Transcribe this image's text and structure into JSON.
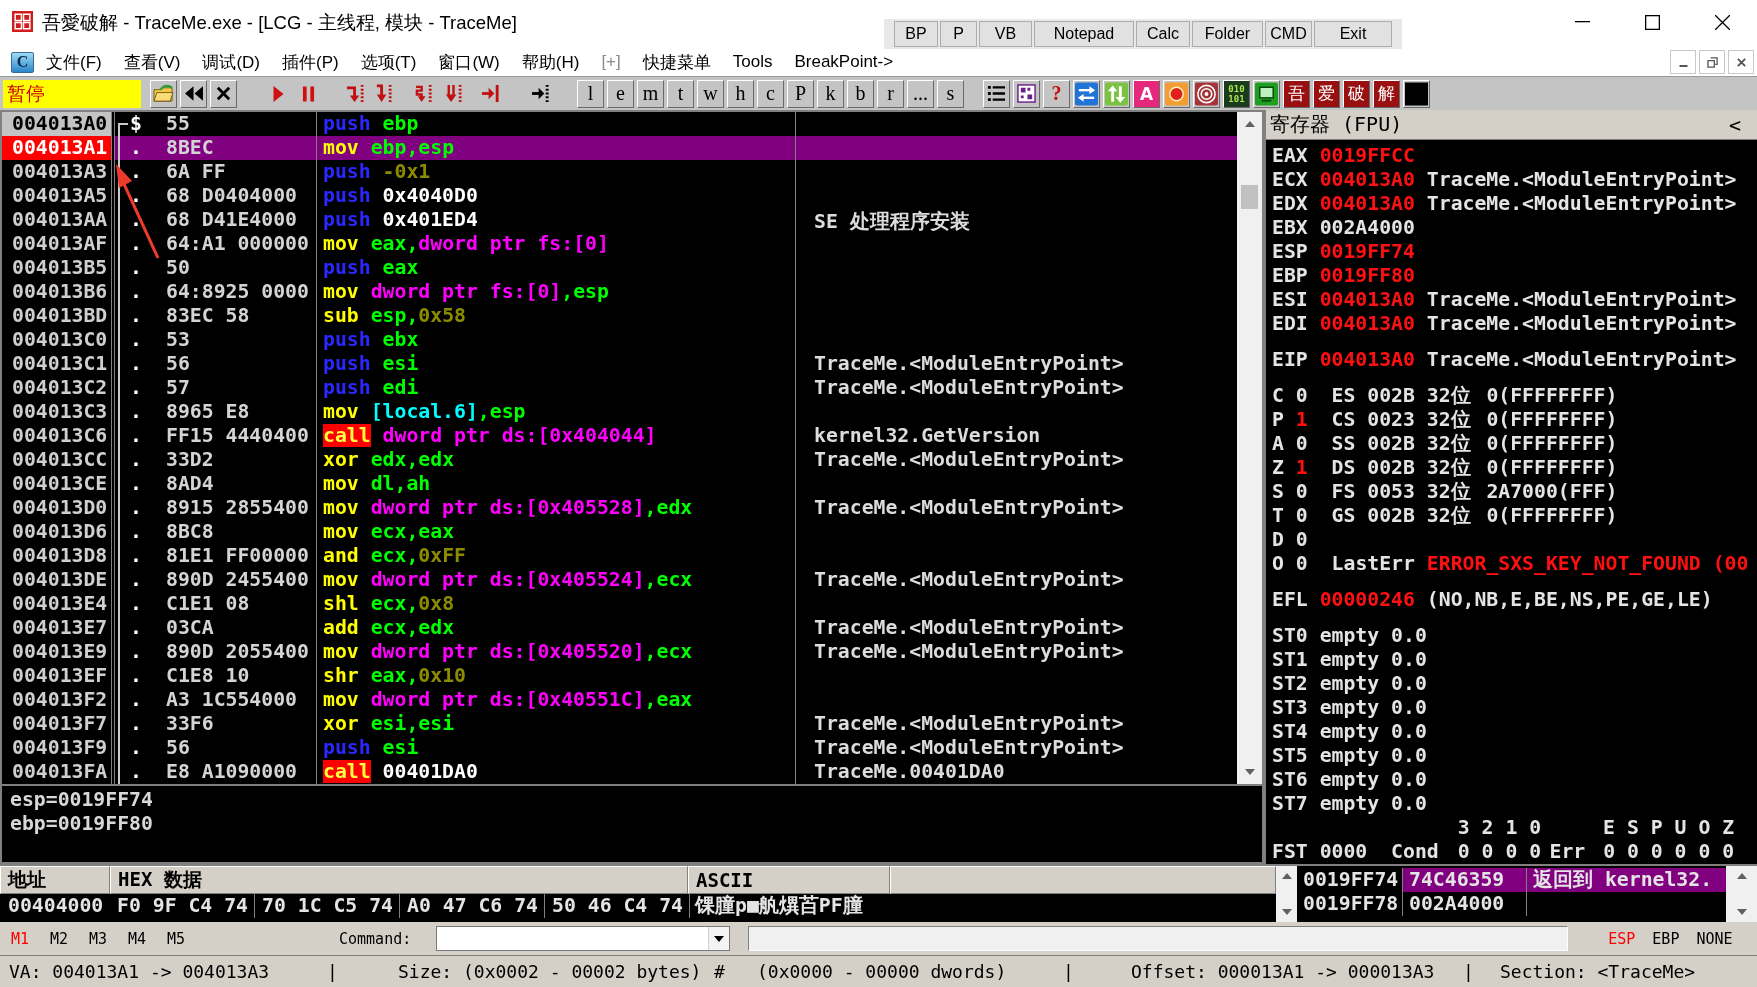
{
  "window": {
    "title": "吾愛破解 - TraceMe.exe - [LCG - 主线程, 模块 - TraceMe]"
  },
  "quick_buttons": [
    "BP",
    "P",
    "VB",
    "Notepad",
    "Calc",
    "Folder",
    "CMD",
    "Exit"
  ],
  "menu": {
    "icon_letter": "C",
    "items": [
      {
        "label": "文件(F)",
        "disabled": false
      },
      {
        "label": "查看(V)",
        "disabled": false
      },
      {
        "label": "调试(D)",
        "disabled": false
      },
      {
        "label": "插件(P)",
        "disabled": false
      },
      {
        "label": "选项(T)",
        "disabled": false
      },
      {
        "label": "窗口(W)",
        "disabled": false
      },
      {
        "label": "帮助(H)",
        "disabled": false
      },
      {
        "label": "[+]",
        "disabled": true
      },
      {
        "label": "快捷菜单",
        "disabled": false
      },
      {
        "label": "Tools",
        "disabled": false
      },
      {
        "label": "BreakPoint->",
        "disabled": false
      }
    ]
  },
  "toolbar": {
    "status": "暂停",
    "letter_buttons": [
      "l",
      "e",
      "m",
      "t",
      "w",
      "h",
      "c",
      "P",
      "k",
      "b",
      "r",
      "...",
      "s"
    ],
    "help_label": "?",
    "letter_tile": "A",
    "binary_tile": [
      "010",
      "101"
    ],
    "glyph_tiles": [
      "吾",
      "爱",
      "破",
      "解"
    ]
  },
  "disassembly": {
    "rows": [
      {
        "address": "004013A0",
        "selected": false,
        "eip": true,
        "marker": "$",
        "hex": "55",
        "mnemonic": {
          "text": "push",
          "kind": "stack"
        },
        "operands": [
          {
            "text": "ebp",
            "kind": "reg"
          }
        ]
      },
      {
        "address": "004013A1",
        "selected": true,
        "eip": false,
        "marker": ".",
        "hex": "8BEC",
        "mnemonic": {
          "text": "mov",
          "kind": "op"
        },
        "operands": [
          {
            "text": "ebp",
            "kind": "reg"
          },
          {
            "text": ",",
            "kind": "sep"
          },
          {
            "text": "esp",
            "kind": "reg"
          }
        ]
      },
      {
        "address": "004013A3",
        "selected": false,
        "eip": false,
        "marker": ".",
        "hex": "6A FF",
        "mnemonic": {
          "text": "push",
          "kind": "stack"
        },
        "operands": [
          {
            "text": "-0x1",
            "kind": "imm"
          }
        ]
      },
      {
        "address": "004013A5",
        "selected": false,
        "eip": false,
        "marker": ".",
        "hex": "68 D0404000",
        "mnemonic": {
          "text": "push",
          "kind": "stack"
        },
        "operands": [
          {
            "text": "0x4040D0",
            "kind": "const"
          }
        ]
      },
      {
        "address": "004013AA",
        "selected": false,
        "eip": false,
        "marker": ".",
        "hex": "68 D41E4000",
        "mnemonic": {
          "text": "push",
          "kind": "stack"
        },
        "operands": [
          {
            "text": "0x401ED4",
            "kind": "const"
          }
        ],
        "comment": "SE 处理程序安装"
      },
      {
        "address": "004013AF",
        "selected": false,
        "eip": false,
        "marker": ".",
        "hex": "64:A1 000000",
        "mnemonic": {
          "text": "mov",
          "kind": "op"
        },
        "operands": [
          {
            "text": "eax",
            "kind": "reg"
          },
          {
            "text": ",",
            "kind": "sep"
          },
          {
            "text": "dword ptr fs:[0]",
            "kind": "mem"
          }
        ]
      },
      {
        "address": "004013B5",
        "selected": false,
        "eip": false,
        "marker": ".",
        "hex": "50",
        "mnemonic": {
          "text": "push",
          "kind": "stack"
        },
        "operands": [
          {
            "text": "eax",
            "kind": "reg"
          }
        ]
      },
      {
        "address": "004013B6",
        "selected": false,
        "eip": false,
        "marker": ".",
        "hex": "64:8925 0000",
        "mnemonic": {
          "text": "mov",
          "kind": "op"
        },
        "operands": [
          {
            "text": "dword ptr fs:[0]",
            "kind": "mem"
          },
          {
            "text": ",",
            "kind": "sep"
          },
          {
            "text": "esp",
            "kind": "reg"
          }
        ]
      },
      {
        "address": "004013BD",
        "selected": false,
        "eip": false,
        "marker": ".",
        "hex": "83EC 58",
        "mnemonic": {
          "text": "sub",
          "kind": "op"
        },
        "operands": [
          {
            "text": "esp",
            "kind": "reg"
          },
          {
            "text": ",",
            "kind": "sep"
          },
          {
            "text": "0x58",
            "kind": "imm"
          }
        ]
      },
      {
        "address": "004013C0",
        "selected": false,
        "eip": false,
        "marker": ".",
        "hex": "53",
        "mnemonic": {
          "text": "push",
          "kind": "stack"
        },
        "operands": [
          {
            "text": "ebx",
            "kind": "reg"
          }
        ]
      },
      {
        "address": "004013C1",
        "selected": false,
        "eip": false,
        "marker": ".",
        "hex": "56",
        "mnemonic": {
          "text": "push",
          "kind": "stack"
        },
        "operands": [
          {
            "text": "esi",
            "kind": "reg"
          }
        ],
        "comment": "TraceMe.<ModuleEntryPoint>"
      },
      {
        "address": "004013C2",
        "selected": false,
        "eip": false,
        "marker": ".",
        "hex": "57",
        "mnemonic": {
          "text": "push",
          "kind": "stack"
        },
        "operands": [
          {
            "text": "edi",
            "kind": "reg"
          }
        ],
        "comment": "TraceMe.<ModuleEntryPoint>"
      },
      {
        "address": "004013C3",
        "selected": false,
        "eip": false,
        "marker": ".",
        "hex": "8965 E8",
        "mnemonic": {
          "text": "mov",
          "kind": "op"
        },
        "operands": [
          {
            "text": "[local.6]",
            "kind": "local"
          },
          {
            "text": ",",
            "kind": "sep"
          },
          {
            "text": "esp",
            "kind": "reg"
          }
        ]
      },
      {
        "address": "004013C6",
        "selected": false,
        "eip": false,
        "marker": ".",
        "hex": "FF15 4440400",
        "mnemonic": {
          "text": "call",
          "kind": "call"
        },
        "operands": [
          {
            "text": "dword ptr ds:[0x404044]",
            "kind": "mem"
          }
        ],
        "comment": "kernel32.GetVersion"
      },
      {
        "address": "004013CC",
        "selected": false,
        "eip": false,
        "marker": ".",
        "hex": "33D2",
        "mnemonic": {
          "text": "xor",
          "kind": "op"
        },
        "operands": [
          {
            "text": "edx",
            "kind": "reg"
          },
          {
            "text": ",",
            "kind": "sep"
          },
          {
            "text": "edx",
            "kind": "reg"
          }
        ],
        "comment": "TraceMe.<ModuleEntryPoint>"
      },
      {
        "address": "004013CE",
        "selected": false,
        "eip": false,
        "marker": ".",
        "hex": "8AD4",
        "mnemonic": {
          "text": "mov",
          "kind": "op"
        },
        "operands": [
          {
            "text": "dl",
            "kind": "reg"
          },
          {
            "text": ",",
            "kind": "sep"
          },
          {
            "text": "ah",
            "kind": "reg"
          }
        ]
      },
      {
        "address": "004013D0",
        "selected": false,
        "eip": false,
        "marker": ".",
        "hex": "8915 2855400",
        "mnemonic": {
          "text": "mov",
          "kind": "op"
        },
        "operands": [
          {
            "text": "dword ptr ds:[0x405528]",
            "kind": "mem"
          },
          {
            "text": ",",
            "kind": "sep"
          },
          {
            "text": "edx",
            "kind": "reg"
          }
        ],
        "comment": "TraceMe.<ModuleEntryPoint>"
      },
      {
        "address": "004013D6",
        "selected": false,
        "eip": false,
        "marker": ".",
        "hex": "8BC8",
        "mnemonic": {
          "text": "mov",
          "kind": "op"
        },
        "operands": [
          {
            "text": "ecx",
            "kind": "reg"
          },
          {
            "text": ",",
            "kind": "sep"
          },
          {
            "text": "eax",
            "kind": "reg"
          }
        ]
      },
      {
        "address": "004013D8",
        "selected": false,
        "eip": false,
        "marker": ".",
        "hex": "81E1 FF00000",
        "mnemonic": {
          "text": "and",
          "kind": "op"
        },
        "operands": [
          {
            "text": "ecx",
            "kind": "reg"
          },
          {
            "text": ",",
            "kind": "sep"
          },
          {
            "text": "0xFF",
            "kind": "imm"
          }
        ]
      },
      {
        "address": "004013DE",
        "selected": false,
        "eip": false,
        "marker": ".",
        "hex": "890D 2455400",
        "mnemonic": {
          "text": "mov",
          "kind": "op"
        },
        "operands": [
          {
            "text": "dword ptr ds:[0x405524]",
            "kind": "mem"
          },
          {
            "text": ",",
            "kind": "sep"
          },
          {
            "text": "ecx",
            "kind": "reg"
          }
        ],
        "comment": "TraceMe.<ModuleEntryPoint>"
      },
      {
        "address": "004013E4",
        "selected": false,
        "eip": false,
        "marker": ".",
        "hex": "C1E1 08",
        "mnemonic": {
          "text": "shl",
          "kind": "op"
        },
        "operands": [
          {
            "text": "ecx",
            "kind": "reg"
          },
          {
            "text": ",",
            "kind": "sep"
          },
          {
            "text": "0x8",
            "kind": "imm"
          }
        ]
      },
      {
        "address": "004013E7",
        "selected": false,
        "eip": false,
        "marker": ".",
        "hex": "03CA",
        "mnemonic": {
          "text": "add",
          "kind": "op"
        },
        "operands": [
          {
            "text": "ecx",
            "kind": "reg"
          },
          {
            "text": ",",
            "kind": "sep"
          },
          {
            "text": "edx",
            "kind": "reg"
          }
        ],
        "comment": "TraceMe.<ModuleEntryPoint>"
      },
      {
        "address": "004013E9",
        "selected": false,
        "eip": false,
        "marker": ".",
        "hex": "890D 2055400",
        "mnemonic": {
          "text": "mov",
          "kind": "op"
        },
        "operands": [
          {
            "text": "dword ptr ds:[0x405520]",
            "kind": "mem"
          },
          {
            "text": ",",
            "kind": "sep"
          },
          {
            "text": "ecx",
            "kind": "reg"
          }
        ],
        "comment": "TraceMe.<ModuleEntryPoint>"
      },
      {
        "address": "004013EF",
        "selected": false,
        "eip": false,
        "marker": ".",
        "hex": "C1E8 10",
        "mnemonic": {
          "text": "shr",
          "kind": "op"
        },
        "operands": [
          {
            "text": "eax",
            "kind": "reg"
          },
          {
            "text": ",",
            "kind": "sep"
          },
          {
            "text": "0x10",
            "kind": "imm"
          }
        ]
      },
      {
        "address": "004013F2",
        "selected": false,
        "eip": false,
        "marker": ".",
        "hex": "A3 1C554000",
        "mnemonic": {
          "text": "mov",
          "kind": "op"
        },
        "operands": [
          {
            "text": "dword ptr ds:[0x40551C]",
            "kind": "mem"
          },
          {
            "text": ",",
            "kind": "sep"
          },
          {
            "text": "eax",
            "kind": "reg"
          }
        ]
      },
      {
        "address": "004013F7",
        "selected": false,
        "eip": false,
        "marker": ".",
        "hex": "33F6",
        "mnemonic": {
          "text": "xor",
          "kind": "op"
        },
        "operands": [
          {
            "text": "esi",
            "kind": "reg"
          },
          {
            "text": ",",
            "kind": "sep"
          },
          {
            "text": "esi",
            "kind": "reg"
          }
        ],
        "comment": "TraceMe.<ModuleEntryPoint>"
      },
      {
        "address": "004013F9",
        "selected": false,
        "eip": false,
        "marker": ".",
        "hex": "56",
        "mnemonic": {
          "text": "push",
          "kind": "stack"
        },
        "operands": [
          {
            "text": "esi",
            "kind": "reg"
          }
        ],
        "comment": "TraceMe.<ModuleEntryPoint>"
      },
      {
        "address": "004013FA",
        "selected": false,
        "eip": false,
        "marker": ".",
        "hex": "E8 A1090000",
        "mnemonic": {
          "text": "call",
          "kind": "call"
        },
        "operands": [
          {
            "text": "00401DA0",
            "kind": "const"
          }
        ],
        "comment": "TraceMe.00401DA0"
      }
    ]
  },
  "info": [
    "esp=0019FF74",
    "ebp=0019FF80"
  ],
  "registers": {
    "title": "寄存器 (FPU)",
    "collapse_label": "<",
    "general": [
      {
        "name": "EAX",
        "value": "0019FFCC",
        "changed": true
      },
      {
        "name": "ECX",
        "value": "004013A0",
        "changed": true,
        "comment": "TraceMe.<ModuleEntryPoint>"
      },
      {
        "name": "EDX",
        "value": "004013A0",
        "changed": true,
        "comment": "TraceMe.<ModuleEntryPoint>"
      },
      {
        "name": "EBX",
        "value": "002A4000",
        "changed": false
      },
      {
        "name": "ESP",
        "value": "0019FF74",
        "changed": true
      },
      {
        "name": "EBP",
        "value": "0019FF80",
        "changed": true
      },
      {
        "name": "ESI",
        "value": "004013A0",
        "changed": true,
        "comment": "TraceMe.<ModuleEntryPoint>"
      },
      {
        "name": "EDI",
        "value": "004013A0",
        "changed": true,
        "comment": "TraceMe.<ModuleEntryPoint>"
      }
    ],
    "eip": {
      "name": "EIP",
      "value": "004013A0",
      "changed": true,
      "comment": "TraceMe.<ModuleEntryPoint>"
    },
    "flags": [
      {
        "kind": "segment",
        "name": "C",
        "value": "0",
        "changed": false,
        "segment": "ES",
        "selector": "002B",
        "bits": "32位",
        "limit": "0(FFFFFFFF)"
      },
      {
        "kind": "segment",
        "name": "P",
        "value": "1",
        "changed": true,
        "segment": "CS",
        "selector": "0023",
        "bits": "32位",
        "limit": "0(FFFFFFFF)"
      },
      {
        "kind": "segment",
        "name": "A",
        "value": "0",
        "changed": false,
        "segment": "SS",
        "selector": "002B",
        "bits": "32位",
        "limit": "0(FFFFFFFF)"
      },
      {
        "kind": "segment",
        "name": "Z",
        "value": "1",
        "changed": true,
        "segment": "DS",
        "selector": "002B",
        "bits": "32位",
        "limit": "0(FFFFFFFF)"
      },
      {
        "kind": "segment",
        "name": "S",
        "value": "0",
        "changed": false,
        "segment": "FS",
        "selector": "0053",
        "bits": "32位",
        "limit": "2A7000(FFF)"
      },
      {
        "kind": "segment",
        "name": "T",
        "value": "0",
        "changed": false,
        "segment": "GS",
        "selector": "002B",
        "bits": "32位",
        "limit": "0(FFFFFFFF)"
      },
      {
        "kind": "plain",
        "name": "D",
        "value": "0",
        "changed": false
      },
      {
        "kind": "last_error",
        "name": "O",
        "value": "0",
        "changed": false,
        "label": "LastErr",
        "error": "ERROR_SXS_KEY_NOT_FOUND (00",
        "error_changed": true
      }
    ],
    "efl": {
      "name": "EFL",
      "value": "00000246",
      "changed": true,
      "decoded": "(NO,NB,E,BE,NS,PE,GE,LE)"
    },
    "fpu": [
      {
        "name": "ST0",
        "tag": "empty",
        "value": "0.0"
      },
      {
        "name": "ST1",
        "tag": "empty",
        "value": "0.0"
      },
      {
        "name": "ST2",
        "tag": "empty",
        "value": "0.0"
      },
      {
        "name": "ST3",
        "tag": "empty",
        "value": "0.0"
      },
      {
        "name": "ST4",
        "tag": "empty",
        "value": "0.0"
      },
      {
        "name": "ST5",
        "tag": "empty",
        "value": "0.0"
      },
      {
        "name": "ST6",
        "tag": "empty",
        "value": "0.0"
      },
      {
        "name": "ST7",
        "tag": "empty",
        "value": "0.0"
      }
    ],
    "fpu_status": {
      "name": "FST",
      "value": "0000",
      "cond_label": "Cond",
      "cond": [
        {
          "bit": "3",
          "value": "0"
        },
        {
          "bit": "2",
          "value": "0"
        },
        {
          "bit": "1",
          "value": "0"
        },
        {
          "bit": "0",
          "value": "0"
        }
      ],
      "err_label": "Err",
      "err": [
        {
          "bit": "E",
          "value": "0"
        },
        {
          "bit": "S",
          "value": "0"
        },
        {
          "bit": "P",
          "value": "0"
        },
        {
          "bit": "U",
          "value": "0"
        },
        {
          "bit": "O",
          "value": "0"
        },
        {
          "bit": "Z",
          "value": "0"
        }
      ]
    }
  },
  "dump": {
    "columns": [
      "地址",
      "HEX 数据",
      "ASCII"
    ],
    "rows": [
      {
        "address": "00404000",
        "hex_groups": [
          "F0 9F C4 74",
          "70 1C C5 74",
          "A0 47 C6 74",
          "50 46 C4 74"
        ],
        "ascii": "馃膧p■舧熼苩PF膧"
      }
    ]
  },
  "stack": {
    "rows": [
      {
        "address": "0019FF74",
        "value": "74C46359",
        "comment": "返回到 kernel32.",
        "selected": true
      },
      {
        "address": "0019FF78",
        "value": "002A4000",
        "selected": false
      }
    ]
  },
  "command_bar": {
    "memory_tabs": [
      {
        "label": "M1",
        "selected": true
      },
      {
        "label": "M2",
        "selected": false
      },
      {
        "label": "M3",
        "selected": false
      },
      {
        "label": "M4",
        "selected": false
      },
      {
        "label": "M5",
        "selected": false
      }
    ],
    "command_label": "Command:",
    "stack_modes": [
      {
        "label": "ESP",
        "selected": true
      },
      {
        "label": "EBP",
        "selected": false
      },
      {
        "label": "NONE",
        "selected": false
      }
    ]
  },
  "status_bar": {
    "items": [
      "VA: 004013A1 -> 004013A3",
      "|",
      "Size: (0x0002 - 00002 bytes)",
      "#",
      "(0x0000 - 00000 dwords)",
      "|",
      "Offset: 000013A1 -> 000013A3",
      "|",
      "Section: <TraceMe>"
    ]
  }
}
